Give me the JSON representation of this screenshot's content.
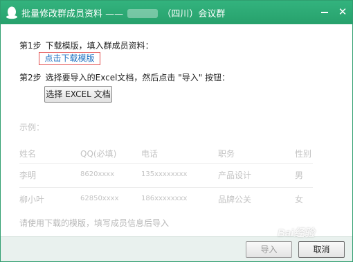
{
  "window": {
    "title_left": "批量修改群成员资料 ——",
    "title_right": "（四川）会议群",
    "minimize_glyph": "—",
    "close_glyph": "✕",
    "accent_color": "#2aa872"
  },
  "icons": {
    "app": "qq-penguin-icon",
    "minimize": "minimize-icon",
    "close": "close-icon"
  },
  "steps": {
    "step1_label": "第1步",
    "step1_text": "下载模版，填入群成员资料：",
    "download_link": "点击下载模版",
    "step2_label": "第2步",
    "step2_text": "选择要导入的Excel文档，然后点击 \"导入\" 按钮：",
    "select_button": "选择 EXCEL 文档"
  },
  "example": {
    "label": "示例：",
    "columns": [
      "姓名",
      "QQ(必填)",
      "电话",
      "职务",
      "性别"
    ],
    "rows": [
      [
        "李明",
        "8620xxxx",
        "135xxxxxxxx",
        "产品设计",
        "男"
      ],
      [
        "柳小叶",
        "62850xxxx",
        "186xxxxxxxx",
        "品牌公关",
        "女"
      ]
    ],
    "note": "请使用下载的模版，填写成员信息后导入"
  },
  "footer": {
    "import_button": "导入",
    "cancel_button": "取消"
  },
  "watermark": "Bai经验"
}
